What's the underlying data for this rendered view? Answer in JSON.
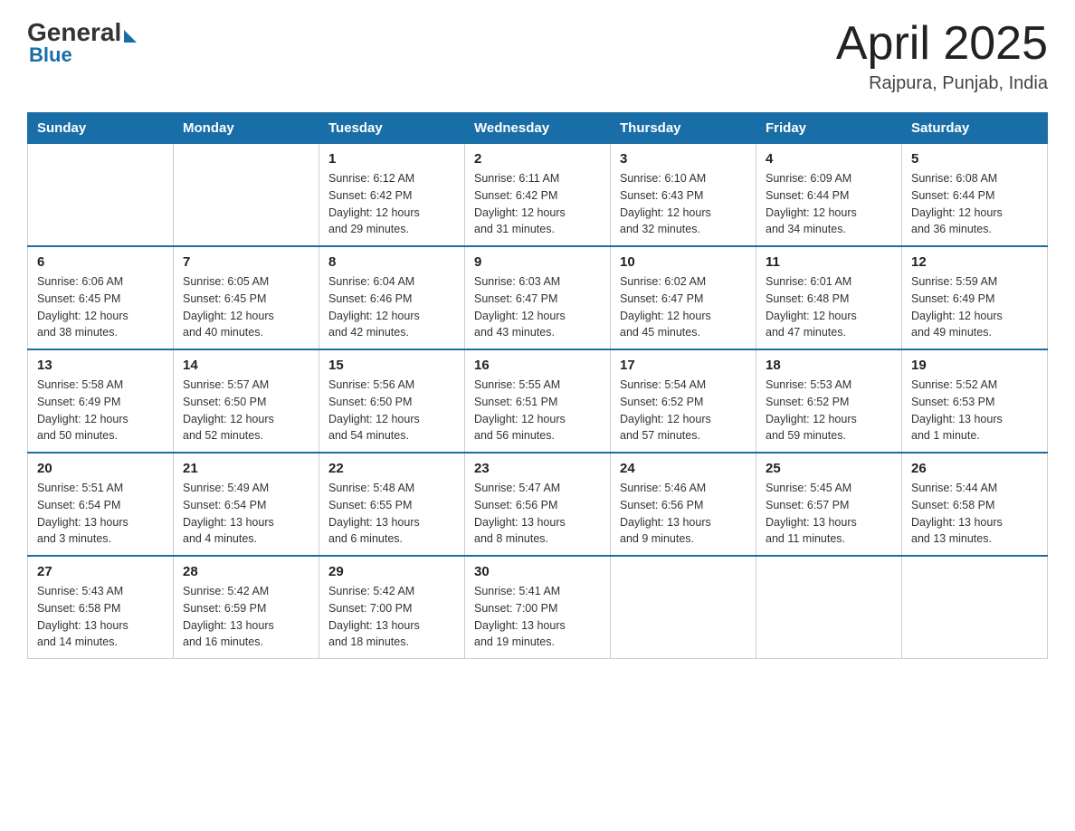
{
  "header": {
    "logo_general": "General",
    "logo_blue": "Blue",
    "month_year": "April 2025",
    "location": "Rajpura, Punjab, India"
  },
  "days_of_week": [
    "Sunday",
    "Monday",
    "Tuesday",
    "Wednesday",
    "Thursday",
    "Friday",
    "Saturday"
  ],
  "weeks": [
    [
      {
        "day": "",
        "info": ""
      },
      {
        "day": "",
        "info": ""
      },
      {
        "day": "1",
        "info": "Sunrise: 6:12 AM\nSunset: 6:42 PM\nDaylight: 12 hours\nand 29 minutes."
      },
      {
        "day": "2",
        "info": "Sunrise: 6:11 AM\nSunset: 6:42 PM\nDaylight: 12 hours\nand 31 minutes."
      },
      {
        "day": "3",
        "info": "Sunrise: 6:10 AM\nSunset: 6:43 PM\nDaylight: 12 hours\nand 32 minutes."
      },
      {
        "day": "4",
        "info": "Sunrise: 6:09 AM\nSunset: 6:44 PM\nDaylight: 12 hours\nand 34 minutes."
      },
      {
        "day": "5",
        "info": "Sunrise: 6:08 AM\nSunset: 6:44 PM\nDaylight: 12 hours\nand 36 minutes."
      }
    ],
    [
      {
        "day": "6",
        "info": "Sunrise: 6:06 AM\nSunset: 6:45 PM\nDaylight: 12 hours\nand 38 minutes."
      },
      {
        "day": "7",
        "info": "Sunrise: 6:05 AM\nSunset: 6:45 PM\nDaylight: 12 hours\nand 40 minutes."
      },
      {
        "day": "8",
        "info": "Sunrise: 6:04 AM\nSunset: 6:46 PM\nDaylight: 12 hours\nand 42 minutes."
      },
      {
        "day": "9",
        "info": "Sunrise: 6:03 AM\nSunset: 6:47 PM\nDaylight: 12 hours\nand 43 minutes."
      },
      {
        "day": "10",
        "info": "Sunrise: 6:02 AM\nSunset: 6:47 PM\nDaylight: 12 hours\nand 45 minutes."
      },
      {
        "day": "11",
        "info": "Sunrise: 6:01 AM\nSunset: 6:48 PM\nDaylight: 12 hours\nand 47 minutes."
      },
      {
        "day": "12",
        "info": "Sunrise: 5:59 AM\nSunset: 6:49 PM\nDaylight: 12 hours\nand 49 minutes."
      }
    ],
    [
      {
        "day": "13",
        "info": "Sunrise: 5:58 AM\nSunset: 6:49 PM\nDaylight: 12 hours\nand 50 minutes."
      },
      {
        "day": "14",
        "info": "Sunrise: 5:57 AM\nSunset: 6:50 PM\nDaylight: 12 hours\nand 52 minutes."
      },
      {
        "day": "15",
        "info": "Sunrise: 5:56 AM\nSunset: 6:50 PM\nDaylight: 12 hours\nand 54 minutes."
      },
      {
        "day": "16",
        "info": "Sunrise: 5:55 AM\nSunset: 6:51 PM\nDaylight: 12 hours\nand 56 minutes."
      },
      {
        "day": "17",
        "info": "Sunrise: 5:54 AM\nSunset: 6:52 PM\nDaylight: 12 hours\nand 57 minutes."
      },
      {
        "day": "18",
        "info": "Sunrise: 5:53 AM\nSunset: 6:52 PM\nDaylight: 12 hours\nand 59 minutes."
      },
      {
        "day": "19",
        "info": "Sunrise: 5:52 AM\nSunset: 6:53 PM\nDaylight: 13 hours\nand 1 minute."
      }
    ],
    [
      {
        "day": "20",
        "info": "Sunrise: 5:51 AM\nSunset: 6:54 PM\nDaylight: 13 hours\nand 3 minutes."
      },
      {
        "day": "21",
        "info": "Sunrise: 5:49 AM\nSunset: 6:54 PM\nDaylight: 13 hours\nand 4 minutes."
      },
      {
        "day": "22",
        "info": "Sunrise: 5:48 AM\nSunset: 6:55 PM\nDaylight: 13 hours\nand 6 minutes."
      },
      {
        "day": "23",
        "info": "Sunrise: 5:47 AM\nSunset: 6:56 PM\nDaylight: 13 hours\nand 8 minutes."
      },
      {
        "day": "24",
        "info": "Sunrise: 5:46 AM\nSunset: 6:56 PM\nDaylight: 13 hours\nand 9 minutes."
      },
      {
        "day": "25",
        "info": "Sunrise: 5:45 AM\nSunset: 6:57 PM\nDaylight: 13 hours\nand 11 minutes."
      },
      {
        "day": "26",
        "info": "Sunrise: 5:44 AM\nSunset: 6:58 PM\nDaylight: 13 hours\nand 13 minutes."
      }
    ],
    [
      {
        "day": "27",
        "info": "Sunrise: 5:43 AM\nSunset: 6:58 PM\nDaylight: 13 hours\nand 14 minutes."
      },
      {
        "day": "28",
        "info": "Sunrise: 5:42 AM\nSunset: 6:59 PM\nDaylight: 13 hours\nand 16 minutes."
      },
      {
        "day": "29",
        "info": "Sunrise: 5:42 AM\nSunset: 7:00 PM\nDaylight: 13 hours\nand 18 minutes."
      },
      {
        "day": "30",
        "info": "Sunrise: 5:41 AM\nSunset: 7:00 PM\nDaylight: 13 hours\nand 19 minutes."
      },
      {
        "day": "",
        "info": ""
      },
      {
        "day": "",
        "info": ""
      },
      {
        "day": "",
        "info": ""
      }
    ]
  ]
}
